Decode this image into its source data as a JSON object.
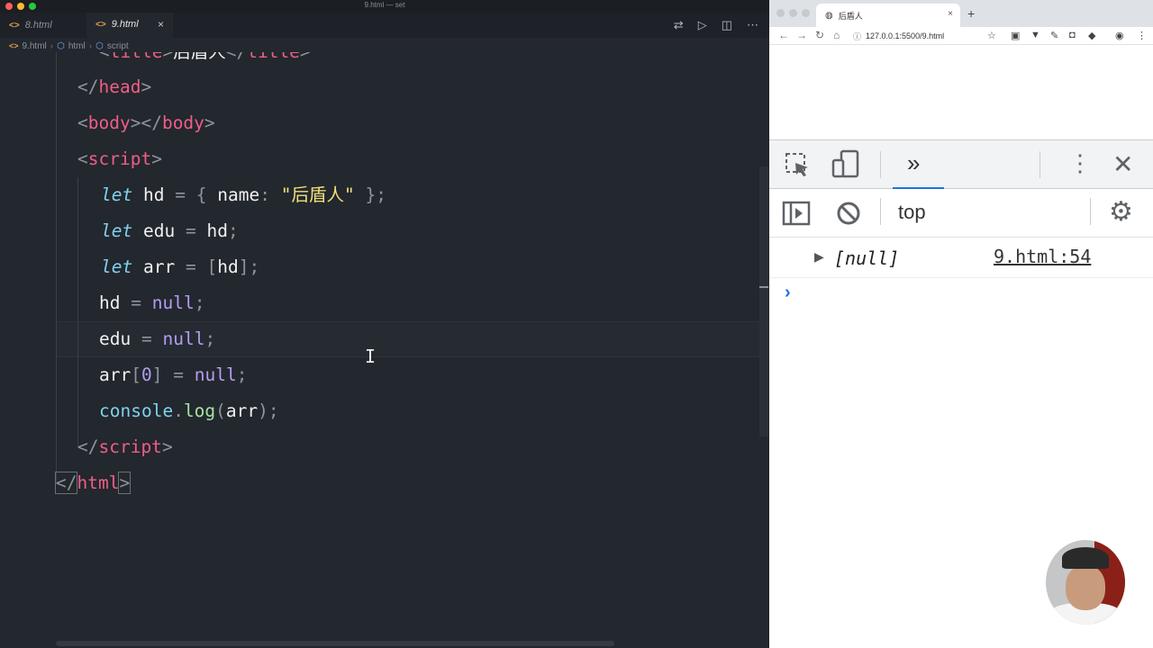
{
  "window": {
    "title": "9.html — set"
  },
  "editor": {
    "tabs": [
      {
        "label": "8.html"
      },
      {
        "label": "9.html",
        "close": "×"
      }
    ],
    "breadcrumb": [
      "9.html",
      "html",
      "script"
    ],
    "code": {
      "line0": {
        "o1": "<",
        "t1": "title",
        "o2": ">",
        "text": "后盾人",
        "o3": "</",
        "t2": "title",
        "o4": ">"
      },
      "line1": {
        "o1": "</",
        "t": "head",
        "o2": ">"
      },
      "line2": {
        "o1": "<",
        "t1": "body",
        "o2": "></",
        "t2": "body",
        "o3": ">"
      },
      "line3": {
        "o1": "<",
        "t": "script",
        "o2": ">"
      },
      "line4": {
        "kw": "let",
        "v": "hd",
        "eq": "=",
        "lb": "{",
        "k": "name",
        "colon": ":",
        "q1": "\"",
        "s": "后盾人",
        "q2": "\"",
        "rb": "};"
      },
      "line5": {
        "kw": "let",
        "v": "edu",
        "eq": "=",
        "v2": "hd",
        "semi": ";"
      },
      "line6": {
        "kw": "let",
        "v": "arr",
        "eq": "=",
        "lb": "[",
        "v2": "hd",
        "rb": "];"
      },
      "line7": {
        "v": "hd",
        "eq": "=",
        "n": "null",
        "semi": ";"
      },
      "line8": {
        "v": "edu",
        "eq": "=",
        "n": "null",
        "semi": ";"
      },
      "line9": {
        "v": "arr",
        "lb": "[",
        "idx": "0",
        "rb": "]",
        "eq": "=",
        "n": "null",
        "semi": ";"
      },
      "line10": {
        "obj": "console",
        "dot": ".",
        "fn": "log",
        "lp": "(",
        "arg": "arr",
        "rp": ");"
      },
      "line11": {
        "o1": "</",
        "t": "script",
        "o2": ">"
      },
      "line12": {
        "o1": "</",
        "t": "html",
        "o2": ">"
      }
    }
  },
  "browser": {
    "tab_title": "后盾人",
    "tab_close": "×",
    "new_tab": "+",
    "url": "127.0.0.1:5500/9.html",
    "devtools": {
      "panel_more": "»",
      "context": "top",
      "log_value": "[null]",
      "log_source": "9.html:54",
      "prompt": "›"
    }
  }
}
